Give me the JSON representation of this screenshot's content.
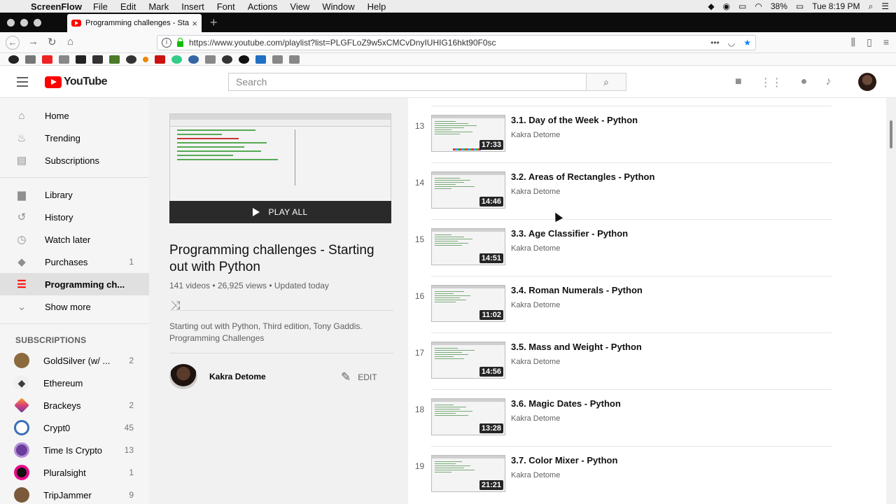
{
  "menubar": {
    "app": "ScreenFlow",
    "items": [
      "File",
      "Edit",
      "Mark",
      "Insert",
      "Font",
      "Actions",
      "View",
      "Window",
      "Help"
    ],
    "battery": "38%",
    "clock": "Tue 8:19 PM"
  },
  "browser": {
    "tab_title": "Programming challenges - Star",
    "url": "https://www.youtube.com/playlist?list=PLGFLoZ9w5xCMCvDnyIUHIG16hkt90F0sc"
  },
  "youtube": {
    "logo_text": "YouTube",
    "search_placeholder": "Search"
  },
  "sidebar": {
    "items": [
      {
        "label": "Home",
        "icon": "home-icon",
        "count": ""
      },
      {
        "label": "Trending",
        "icon": "flame-icon",
        "count": ""
      },
      {
        "label": "Subscriptions",
        "icon": "subscriptions-icon",
        "count": ""
      },
      {
        "label": "Library",
        "icon": "folder-icon",
        "count": ""
      },
      {
        "label": "History",
        "icon": "history-icon",
        "count": ""
      },
      {
        "label": "Watch later",
        "icon": "clock-icon",
        "count": ""
      },
      {
        "label": "Purchases",
        "icon": "tag-icon",
        "count": "1"
      },
      {
        "label": "Programming ch...",
        "icon": "playlist-icon",
        "count": ""
      },
      {
        "label": "Show more",
        "icon": "chevron-down-icon",
        "count": ""
      }
    ],
    "subscriptions_heading": "SUBSCRIPTIONS",
    "subscriptions": [
      {
        "label": "GoldSilver (w/ ...",
        "count": "2",
        "color": "#8b6a3e"
      },
      {
        "label": "Ethereum",
        "count": "",
        "color": "#3c3c3d"
      },
      {
        "label": "Brackeys",
        "count": "2",
        "color": "#d9407a"
      },
      {
        "label": "Crypt0",
        "count": "45",
        "color": "#3b6fb6"
      },
      {
        "label": "Time Is Crypto",
        "count": "13",
        "color": "#6a3d9a"
      },
      {
        "label": "Pluralsight",
        "count": "1",
        "color": "#e80a89"
      },
      {
        "label": "TripJammer",
        "count": "9",
        "color": "#7a5a3a"
      }
    ]
  },
  "playlist": {
    "play_all": "PLAY ALL",
    "title": "Programming challenges - Starting out with Python",
    "videos": "141 videos",
    "views": "26,925 views",
    "updated": "Updated today",
    "description": "Starting out with Python, Third edition, Tony Gaddis. Programming Challenges",
    "owner": "Kakra Detome",
    "edit_label": "EDIT"
  },
  "videos": [
    {
      "index": "13",
      "title": "3.1. Day of the Week - Python",
      "channel": "Kakra Detome",
      "duration": "17:33"
    },
    {
      "index": "14",
      "title": "3.2. Areas of Rectangles - Python",
      "channel": "Kakra Detome",
      "duration": "14:46"
    },
    {
      "index": "15",
      "title": "3.3. Age Classifier - Python",
      "channel": "Kakra Detome",
      "duration": "14:51"
    },
    {
      "index": "16",
      "title": "3.4. Roman Numerals - Python",
      "channel": "Kakra Detome",
      "duration": "11:02"
    },
    {
      "index": "17",
      "title": "3.5. Mass and Weight - Python",
      "channel": "Kakra Detome",
      "duration": "14:56"
    },
    {
      "index": "18",
      "title": "3.6. Magic Dates - Python",
      "channel": "Kakra Detome",
      "duration": "13:28"
    },
    {
      "index": "19",
      "title": "3.7. Color Mixer - Python",
      "channel": "Kakra Detome",
      "duration": "21:21"
    }
  ],
  "colors": {
    "brand_red": "#ff0000",
    "active_bg": "#e0e0e0"
  }
}
